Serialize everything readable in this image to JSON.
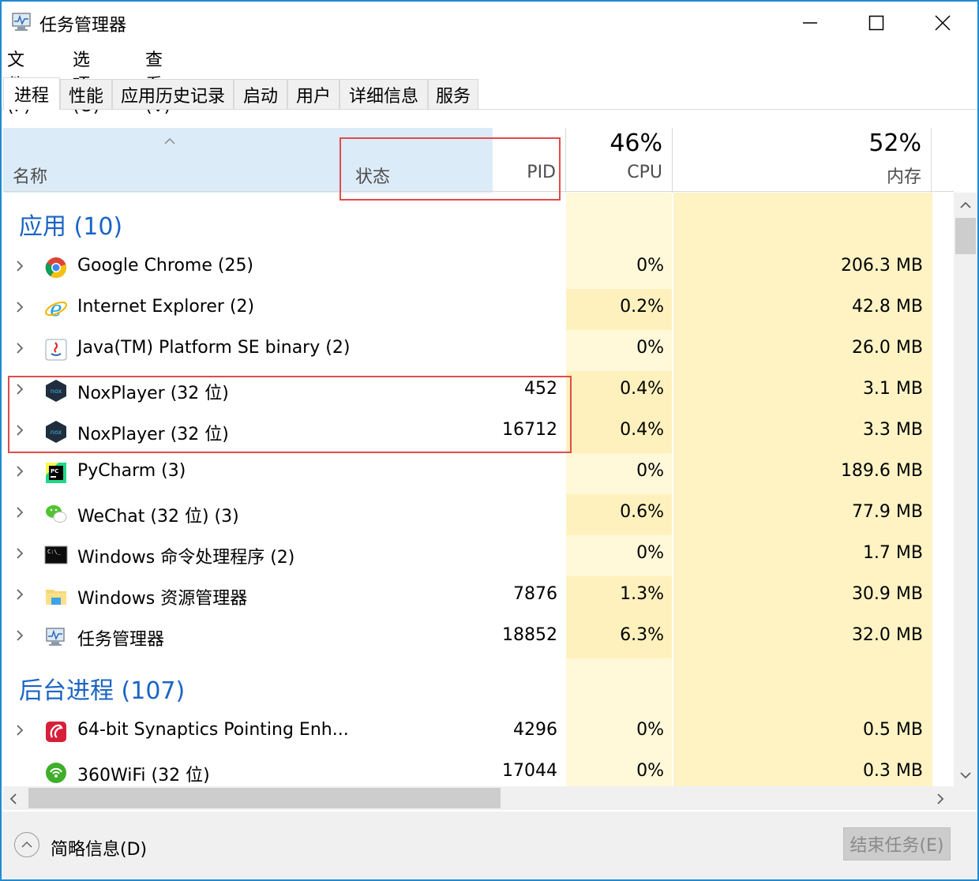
{
  "window": {
    "title": "任务管理器",
    "controls": {
      "minimize": "—",
      "maximize": "☐",
      "close": "✕"
    },
    "accent_color": "#1f8ad2"
  },
  "menu": [
    "文件(F)",
    "选项(O)",
    "查看(V)"
  ],
  "tabs": [
    {
      "label": "进程",
      "active": true
    },
    {
      "label": "性能"
    },
    {
      "label": "应用历史记录"
    },
    {
      "label": "启动"
    },
    {
      "label": "用户"
    },
    {
      "label": "详细信息"
    },
    {
      "label": "服务"
    }
  ],
  "header": {
    "name": "名称",
    "status": "状态",
    "pid": "PID",
    "cpu_percent": "46%",
    "cpu": "CPU",
    "mem_percent": "52%",
    "mem": "内存",
    "sort_arrow": "^"
  },
  "groups": {
    "apps": "应用 (10)",
    "background": "后台进程 (107)"
  },
  "rows": [
    {
      "icon": "chrome-icon",
      "name": "Google Chrome (25)",
      "pid": "",
      "cpu": "0%",
      "mem": "206.3 MB"
    },
    {
      "icon": "ie-icon",
      "name": "Internet Explorer (2)",
      "pid": "",
      "cpu": "0.2%",
      "mem": "42.8 MB"
    },
    {
      "icon": "java-icon",
      "name": "Java(TM) Platform SE binary (2)",
      "pid": "",
      "cpu": "0%",
      "mem": "26.0 MB"
    },
    {
      "icon": "nox-icon",
      "name": "NoxPlayer (32 位)",
      "pid": "452",
      "cpu": "0.4%",
      "mem": "3.1 MB"
    },
    {
      "icon": "nox-icon",
      "name": "NoxPlayer (32 位)",
      "pid": "16712",
      "cpu": "0.4%",
      "mem": "3.3 MB"
    },
    {
      "icon": "pycharm-icon",
      "name": "PyCharm (3)",
      "pid": "",
      "cpu": "0%",
      "mem": "189.6 MB"
    },
    {
      "icon": "wechat-icon",
      "name": "WeChat (32 位) (3)",
      "pid": "",
      "cpu": "0.6%",
      "mem": "77.9 MB"
    },
    {
      "icon": "cmd-icon",
      "name": "Windows 命令处理程序 (2)",
      "pid": "",
      "cpu": "0%",
      "mem": "1.7 MB"
    },
    {
      "icon": "explorer-icon",
      "name": "Windows 资源管理器",
      "pid": "7876",
      "cpu": "1.3%",
      "mem": "30.9 MB"
    },
    {
      "icon": "taskmgr-icon",
      "name": "任务管理器",
      "pid": "18852",
      "cpu": "6.3%",
      "mem": "32.0 MB"
    }
  ],
  "bg_rows": [
    {
      "icon": "synaptics-icon",
      "name": "64-bit Synaptics Pointing Enh...",
      "pid": "4296",
      "cpu": "0%",
      "mem": "0.5 MB"
    },
    {
      "icon": "wifi360-icon",
      "name": "360WiFi (32 位)",
      "pid": "17044",
      "cpu": "0%",
      "mem": "0.3 MB"
    }
  ],
  "footer": {
    "fewer_details": "简略信息(D)",
    "end_task": "结束任务(E)"
  },
  "colors": {
    "group_text": "#1b64c4",
    "cpu_low": "#fff8d9",
    "cpu_mid": "#fff1bd",
    "mem": "#fff3c4",
    "highlight_box": "#e24b4b"
  }
}
